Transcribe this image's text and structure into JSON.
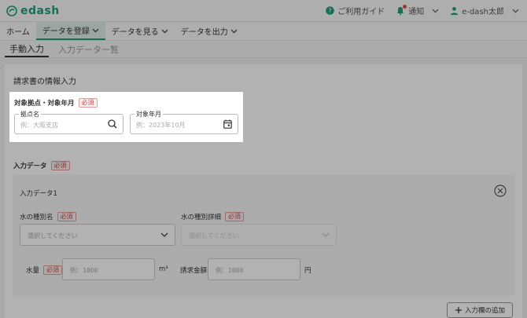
{
  "header": {
    "logo_text": "edash",
    "guide_label": "ご利用ガイド",
    "notify_label": "通知",
    "user_label": "e-dash太郎"
  },
  "nav": {
    "items": [
      {
        "label": "ホーム"
      },
      {
        "label": "データを登録"
      },
      {
        "label": "データを見る"
      },
      {
        "label": "データを出力"
      }
    ]
  },
  "subtabs": [
    {
      "label": "手動入力"
    },
    {
      "label": "入力データ一覧"
    }
  ],
  "billing": {
    "section_title": "請求書の情報入力",
    "target_label": "対象拠点・対象年月",
    "required_badge": "必須",
    "site_field": {
      "legend": "拠点名",
      "placeholder": "例：大阪支店"
    },
    "month_field": {
      "legend": "対象年月",
      "placeholder": "例：2023年10月"
    }
  },
  "input_data": {
    "label": "入力データ",
    "required_badge": "必須",
    "card_title": "入力データ1",
    "water_type": {
      "label": "水の種別名",
      "badge": "必須",
      "placeholder": "選択してください"
    },
    "water_type_detail": {
      "label": "水の種別詳細",
      "badge": "必須",
      "placeholder": "選択してください"
    },
    "water_amount": {
      "label": "水量",
      "badge": "必須",
      "placeholder": "例：1000",
      "unit": "m³"
    },
    "billing_amount": {
      "label": "請求金額",
      "placeholder": "例：1000",
      "unit": "円"
    },
    "add_button": "入力欄の追加"
  },
  "colors": {
    "brand": "#1f9e7a",
    "required": "#d04a4a"
  }
}
